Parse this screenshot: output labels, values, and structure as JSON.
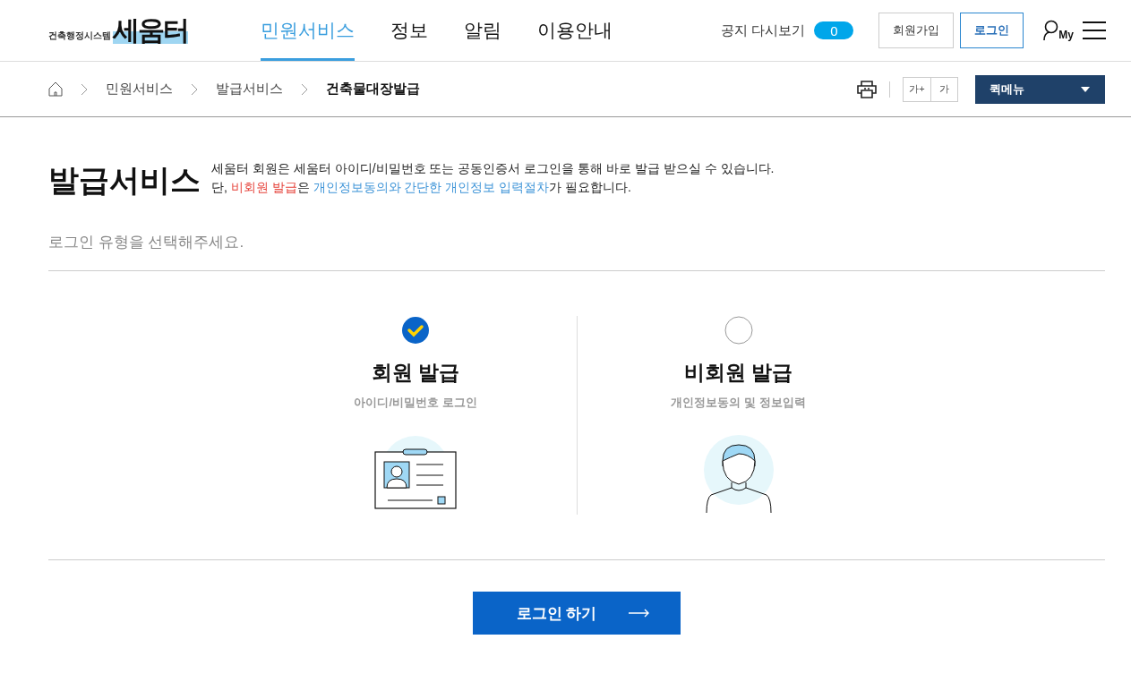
{
  "header": {
    "logo": {
      "wordmark": "세움터",
      "subtitle": "건축행정시스템"
    },
    "nav": [
      {
        "label": "민원서비스",
        "selected": true
      },
      {
        "label": "정보",
        "selected": false
      },
      {
        "label": "알림",
        "selected": false
      },
      {
        "label": "이용안내",
        "selected": false
      }
    ],
    "notice": {
      "label": "공지 다시보기",
      "count": "0"
    },
    "buttons": [
      {
        "label": "회원가입",
        "kind": "plain"
      },
      {
        "label": "로그인",
        "kind": "primary"
      }
    ],
    "my_label": "My"
  },
  "breadcrumb": {
    "items": [
      {
        "label": "민원서비스",
        "current": false
      },
      {
        "label": "발급서비스",
        "current": false
      },
      {
        "label": "건축물대장발급",
        "current": true
      }
    ],
    "font_buttons": [
      "가+",
      "가"
    ],
    "quick_menu": "퀵메뉴"
  },
  "intro": {
    "title": "발급서비스",
    "lines": [
      [
        {
          "text": "세움터 회원은 세움터 아이디/비밀번호 또는 공동인증서 로그인을 통해 바로 발급 받으실 수 있습니다."
        }
      ],
      [
        {
          "text": "단, "
        },
        {
          "text": "비회원 발급",
          "color": "#e6433b"
        },
        {
          "text": "은 "
        },
        {
          "text": "개인정보동의와 간단한 개인정보 입력절차",
          "color": "#3f95d8"
        },
        {
          "text": "가 필요합니다."
        }
      ]
    ]
  },
  "prompt": "로그인 유형을 선택해주세요.",
  "options": [
    {
      "title": "회원 발급",
      "subtitle": "아이디/비밀번호 로그인",
      "selected": true,
      "kind": "id-card"
    },
    {
      "title": "비회원 발급",
      "subtitle": "개인정보동의 및 정보입력",
      "selected": false,
      "kind": "person"
    }
  ],
  "submit": "로그인 하기"
}
